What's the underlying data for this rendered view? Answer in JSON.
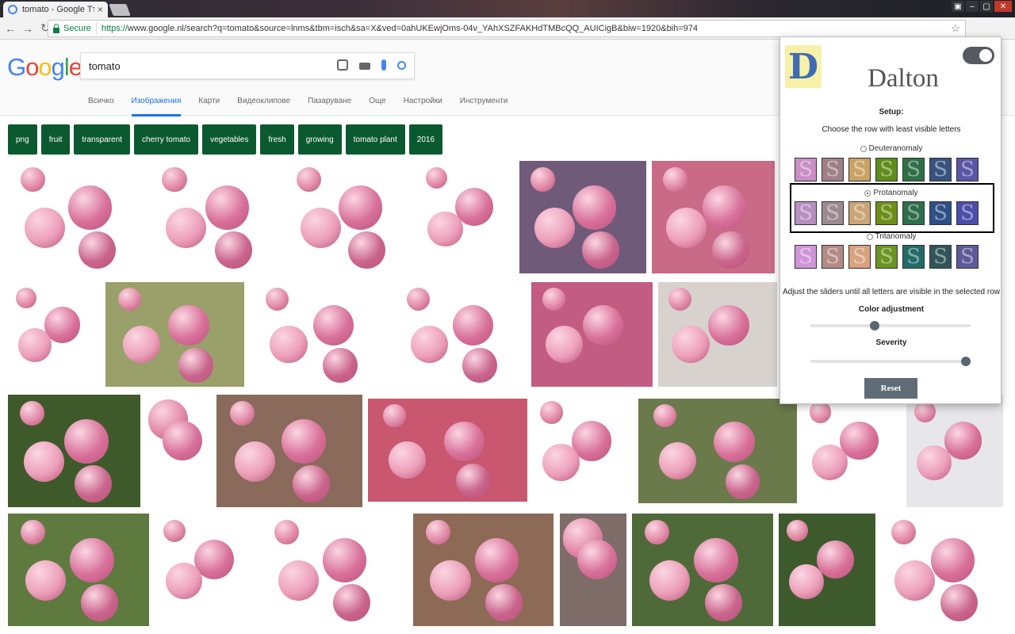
{
  "browser": {
    "tab_title": "tomato - Google Търсен",
    "tab_close": "×",
    "secure_label": "Secure",
    "url_scheme": "https://",
    "url_rest": "www.google.nl/search?q=tomato&source=lnms&tbm=isch&sa=X&ved=0ahUKEwjOms-04v_YAhXSZFAKHdTMBcQQ_AUICigB&biw=1920&bih=974",
    "ext_dalton_label": "D"
  },
  "google": {
    "logo_letters": [
      "G",
      "o",
      "o",
      "g",
      "l",
      "e"
    ],
    "logo_colors": [
      "#4285f4",
      "#ea4335",
      "#fbbc05",
      "#4285f4",
      "#34a853",
      "#ea4335"
    ],
    "query": "tomato",
    "tabs": [
      "Всичко",
      "Изображения",
      "Карти",
      "Видеоклипове",
      "Пазаруване",
      "Още",
      "Настройки",
      "Инструменти"
    ],
    "active_tab": "Изображения"
  },
  "chips": [
    "png",
    "fruit",
    "transparent",
    "cherry tomato",
    "vegetables",
    "fresh",
    "growing",
    "tomato plant",
    "2016"
  ],
  "dalton": {
    "logo_letter": "D",
    "title": "Dalton",
    "setup": "Setup:",
    "choose": "Choose the row with least visible letters",
    "rows": [
      {
        "label": "Deuteranomaly",
        "selected": false,
        "letter": "S",
        "colors": [
          "#c98fc6",
          "#a07f88",
          "#caa264",
          "#5f8d1a",
          "#2f6f48",
          "#37527f",
          "#5b55a5"
        ]
      },
      {
        "label": "Protanomaly",
        "selected": true,
        "letter": "S",
        "colors": [
          "#b78fc0",
          "#9d8a90",
          "#c9a475",
          "#6d8f18",
          "#2e6e4a",
          "#2e4f86",
          "#4b4ea7"
        ]
      },
      {
        "label": "Tritanomaly",
        "selected": false,
        "letter": "S",
        "colors": [
          "#cf95d8",
          "#b48a85",
          "#d7a27e",
          "#6a9522",
          "#226b67",
          "#2f5558",
          "#5e5a97"
        ]
      }
    ],
    "adjust": "Adjust the sliders until all letters are visible in the selected row",
    "color_adjustment_label": "Color adjustment",
    "color_adjustment_value": 0.4,
    "severity_label": "Severity",
    "severity_value": 0.97,
    "reset_label": "Reset"
  }
}
